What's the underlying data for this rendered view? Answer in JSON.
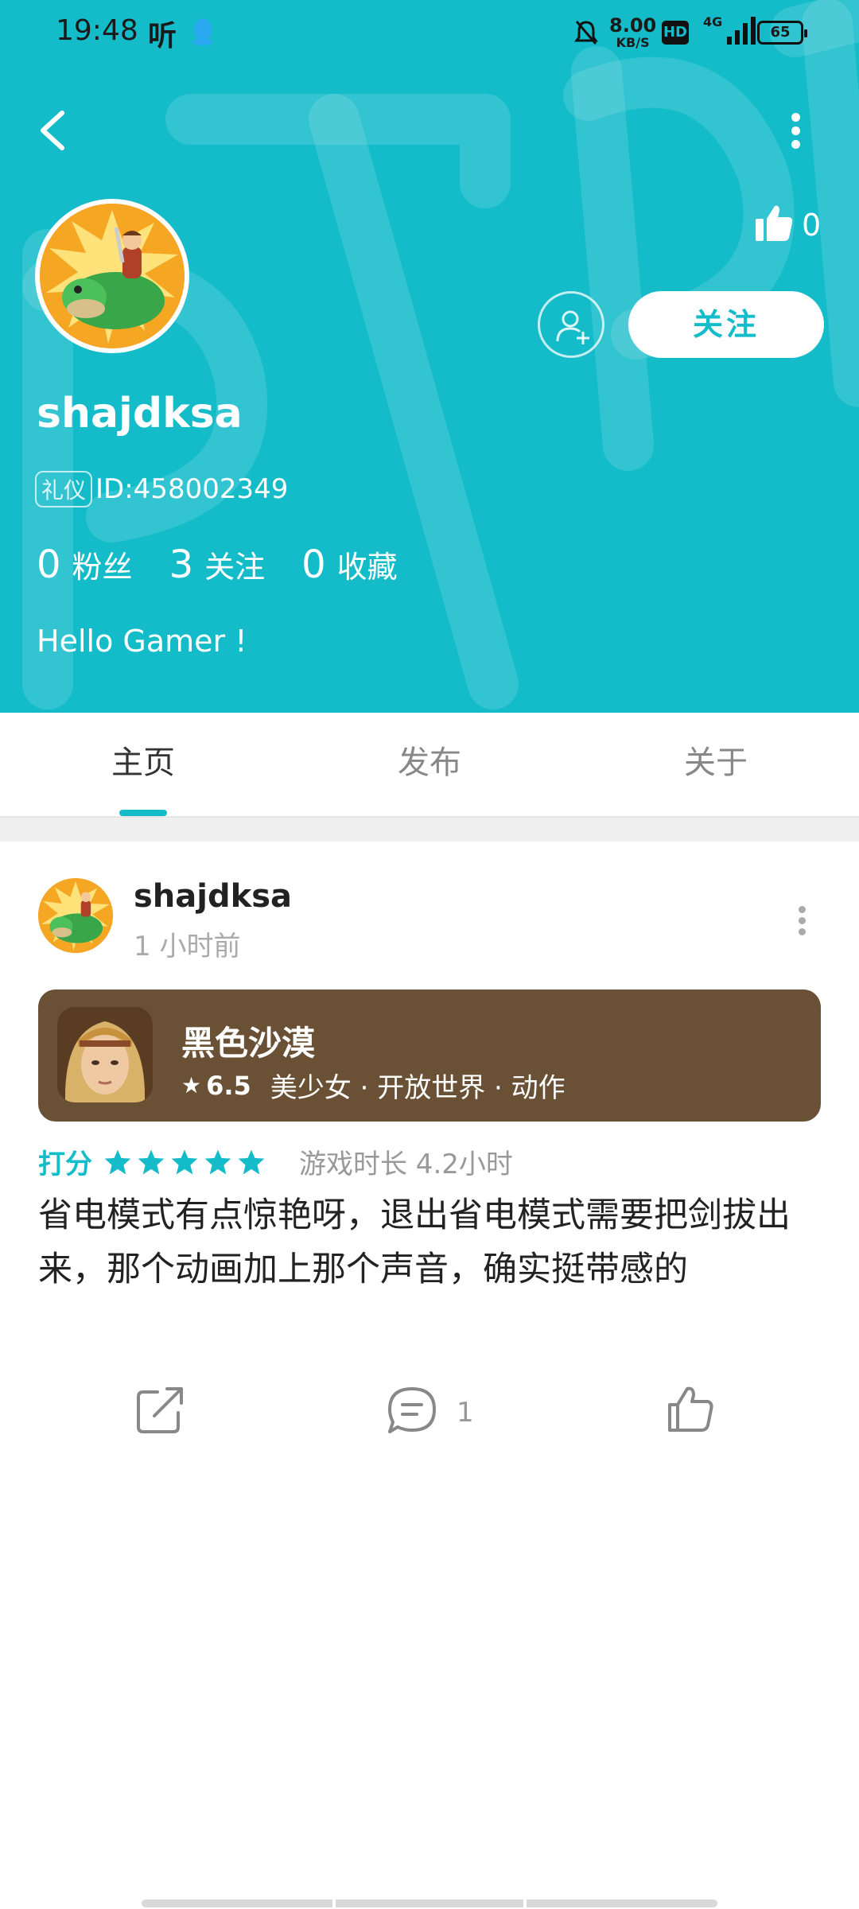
{
  "status_bar": {
    "time": "19:48",
    "app_glyph": "听",
    "net_speed_value": "8.00",
    "net_speed_unit": "KB/S",
    "hd": "HD",
    "network": "4G",
    "battery": "65"
  },
  "profile": {
    "username": "shajdksa",
    "badge": "礼仪",
    "id_text": "ID:458002349",
    "likes": "0",
    "follow_label": "关注",
    "stats": [
      {
        "num": "0",
        "label": "粉丝"
      },
      {
        "num": "3",
        "label": "关注"
      },
      {
        "num": "0",
        "label": "收藏"
      }
    ],
    "bio": "Hello Gamer !"
  },
  "tabs": [
    {
      "label": "主页",
      "active": true
    },
    {
      "label": "发布",
      "active": false
    },
    {
      "label": "关于",
      "active": false
    }
  ],
  "post": {
    "author": "shajdksa",
    "time": "1 小时前",
    "game": {
      "name": "黑色沙漠",
      "score": "6.5",
      "tags": "美少女 · 开放世界 · 动作"
    },
    "rating_label": "打分",
    "rating_stars": 5,
    "play_time": "游戏时长 4.2小时",
    "body": "省电模式有点惊艳呀，退出省电模式需要把剑拔出来，那个动画加上那个声音，确实挺带感的",
    "comment_count": "1"
  },
  "colors": {
    "accent": "#14bcc9",
    "game_card": "#6a5034"
  }
}
